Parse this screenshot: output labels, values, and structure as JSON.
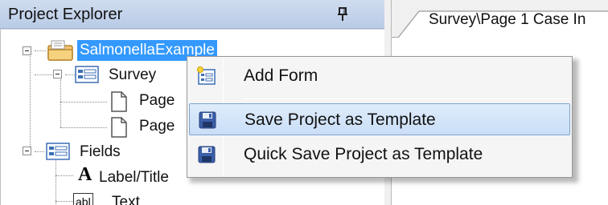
{
  "explorer": {
    "title": "Project Explorer",
    "pin_icon": "pin-icon",
    "tree": {
      "project": {
        "label": "SalmonellaExample",
        "icon": "project-folder-icon",
        "selected": true
      },
      "survey": {
        "label": "Survey",
        "icon": "form-icon"
      },
      "pages": [
        {
          "label": "Page",
          "icon": "page-icon"
        },
        {
          "label": "Page",
          "icon": "page-icon"
        }
      ],
      "fields": {
        "label": "Fields",
        "icon": "form-icon"
      },
      "field_types": [
        {
          "label": "Label/Title",
          "icon": "label-title-icon",
          "glyph": "A"
        },
        {
          "label": "Text",
          "icon": "text-field-icon",
          "glyph": "abl"
        }
      ]
    }
  },
  "document": {
    "tab_label": "Survey\\Page 1 Case In"
  },
  "context_menu": {
    "items": [
      {
        "label": "Add Form",
        "icon": "add-form-icon",
        "highlighted": false
      },
      {
        "label": "Save Project as Template",
        "icon": "save-icon",
        "highlighted": true
      },
      {
        "label": "Quick Save Project as Template",
        "icon": "save-icon",
        "highlighted": false
      }
    ]
  },
  "colors": {
    "selection": "#3399ff",
    "header": "#c4d4ec",
    "menu_highlight": "#d4e4f8",
    "menu_highlight_border": "#7da2ce"
  }
}
